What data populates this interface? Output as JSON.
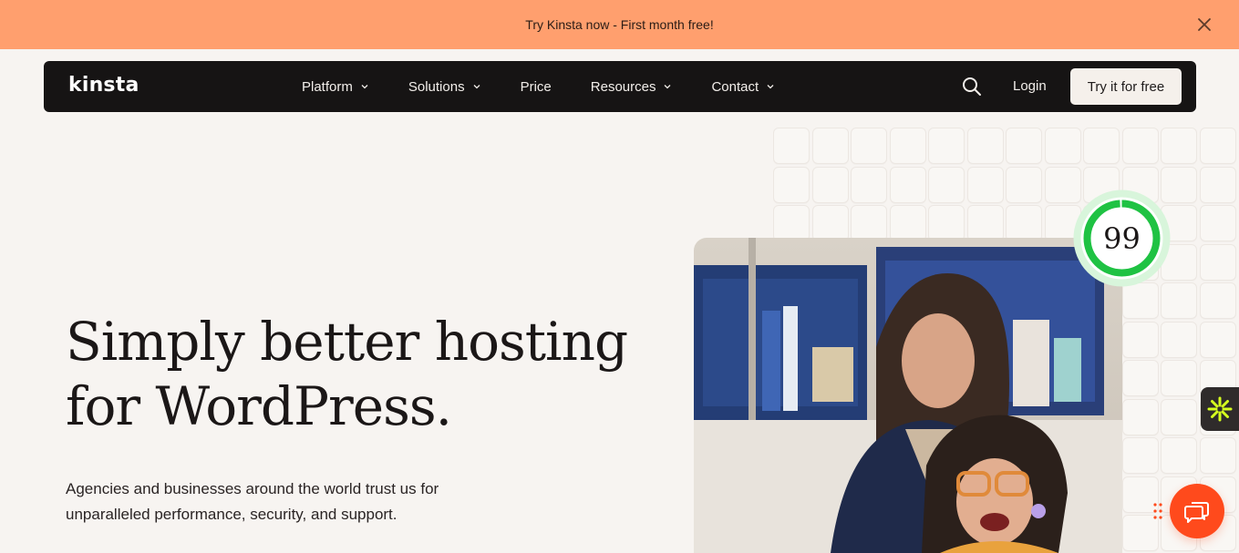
{
  "promo": {
    "text": "Try Kinsta now - First month free!",
    "close_icon": "close-icon"
  },
  "nav": {
    "logo": "kinsta",
    "items": [
      {
        "label": "Platform",
        "has_dropdown": true
      },
      {
        "label": "Solutions",
        "has_dropdown": true
      },
      {
        "label": "Price",
        "has_dropdown": false
      },
      {
        "label": "Resources",
        "has_dropdown": true
      },
      {
        "label": "Contact",
        "has_dropdown": true
      }
    ],
    "search_icon": "search-icon",
    "login": "Login",
    "cta": "Try it for free"
  },
  "hero": {
    "title_line1": "Simply better hosting",
    "title_line2": "for WordPress.",
    "subtitle_line1": "Agencies and businesses around the world trust us for",
    "subtitle_line2": "unparalleled performance, security, and support."
  },
  "score_badge": {
    "value": "99",
    "ring_color": "#1fc243",
    "progress": 0.99
  },
  "side_widget": {
    "icon": "asterisk-icon",
    "color": "#d6ff1f"
  },
  "chat": {
    "icon": "chat-bubbles-icon",
    "color": "#ff4a1c"
  },
  "colors": {
    "banner": "#ff9f6e",
    "nav_bg": "#161414",
    "page_bg": "#f7f4f1"
  }
}
